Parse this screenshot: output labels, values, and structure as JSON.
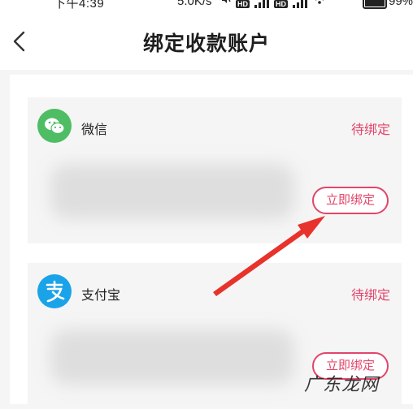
{
  "status_bar": {
    "time": "下午4:39",
    "net_speed": "5.0K/s",
    "battery": "99%",
    "icons": [
      "mute-icon",
      "hd-signal-icon",
      "signal-bars-icon",
      "hd-signal-icon",
      "signal-bars-icon",
      "wifi-icon",
      "battery-icon"
    ]
  },
  "nav": {
    "back_icon": "chevron-left-icon",
    "title": "绑定收款账户"
  },
  "accounts": [
    {
      "name": "微信",
      "status": "待绑定",
      "button_label": "立即绑定",
      "icon": "wechat-icon",
      "icon_color": "#4ebd63"
    },
    {
      "name": "支付宝",
      "status": "待绑定",
      "button_label": "立即绑定",
      "icon": "alipay-icon",
      "icon_color": "#1aa3e8"
    }
  ],
  "annotation": {
    "icon": "red-arrow-icon",
    "color": "#e8322c"
  },
  "watermark": "广东龙网",
  "colors": {
    "accent": "#e2456a"
  }
}
